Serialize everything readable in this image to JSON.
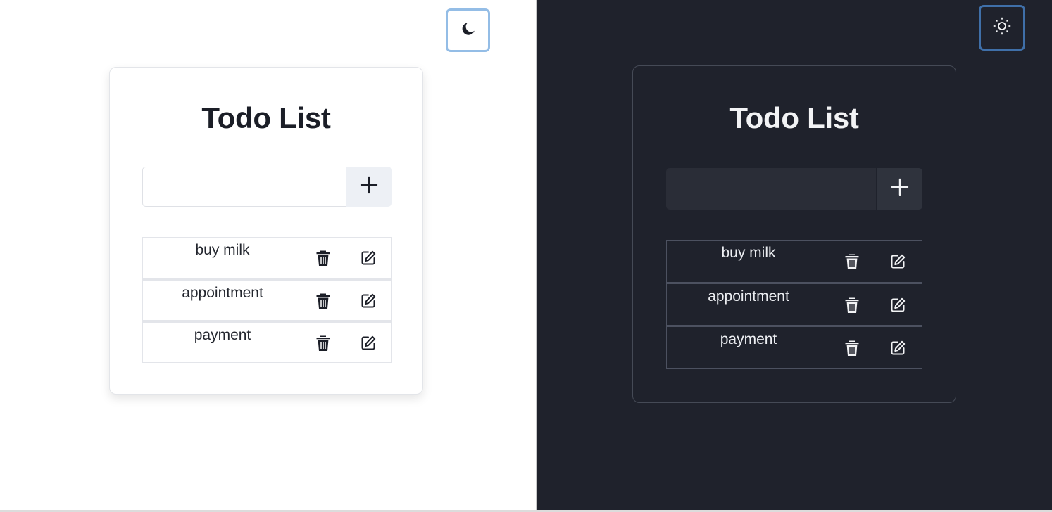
{
  "colors": {
    "light_background": "#ffffff",
    "dark_background": "#1f222c",
    "light_toggle_border": "#94bde6",
    "dark_toggle_border": "#3f6fa8"
  },
  "light_view": {
    "theme_toggle": {
      "icon": "moon-icon"
    },
    "title": "Todo List",
    "input": {
      "value": "",
      "placeholder": ""
    },
    "add_button": {
      "icon": "plus-icon"
    },
    "todos": [
      {
        "label": "buy milk",
        "delete_icon": "trash-icon",
        "edit_icon": "edit-icon"
      },
      {
        "label": "appointment",
        "delete_icon": "trash-icon",
        "edit_icon": "edit-icon"
      },
      {
        "label": "payment",
        "delete_icon": "trash-icon",
        "edit_icon": "edit-icon"
      }
    ]
  },
  "dark_view": {
    "theme_toggle": {
      "icon": "sun-icon"
    },
    "title": "Todo List",
    "input": {
      "value": "",
      "placeholder": ""
    },
    "add_button": {
      "icon": "plus-icon"
    },
    "todos": [
      {
        "label": "buy milk",
        "delete_icon": "trash-icon",
        "edit_icon": "edit-icon"
      },
      {
        "label": "appointment",
        "delete_icon": "trash-icon",
        "edit_icon": "edit-icon"
      },
      {
        "label": "payment",
        "delete_icon": "trash-icon",
        "edit_icon": "edit-icon"
      }
    ]
  }
}
